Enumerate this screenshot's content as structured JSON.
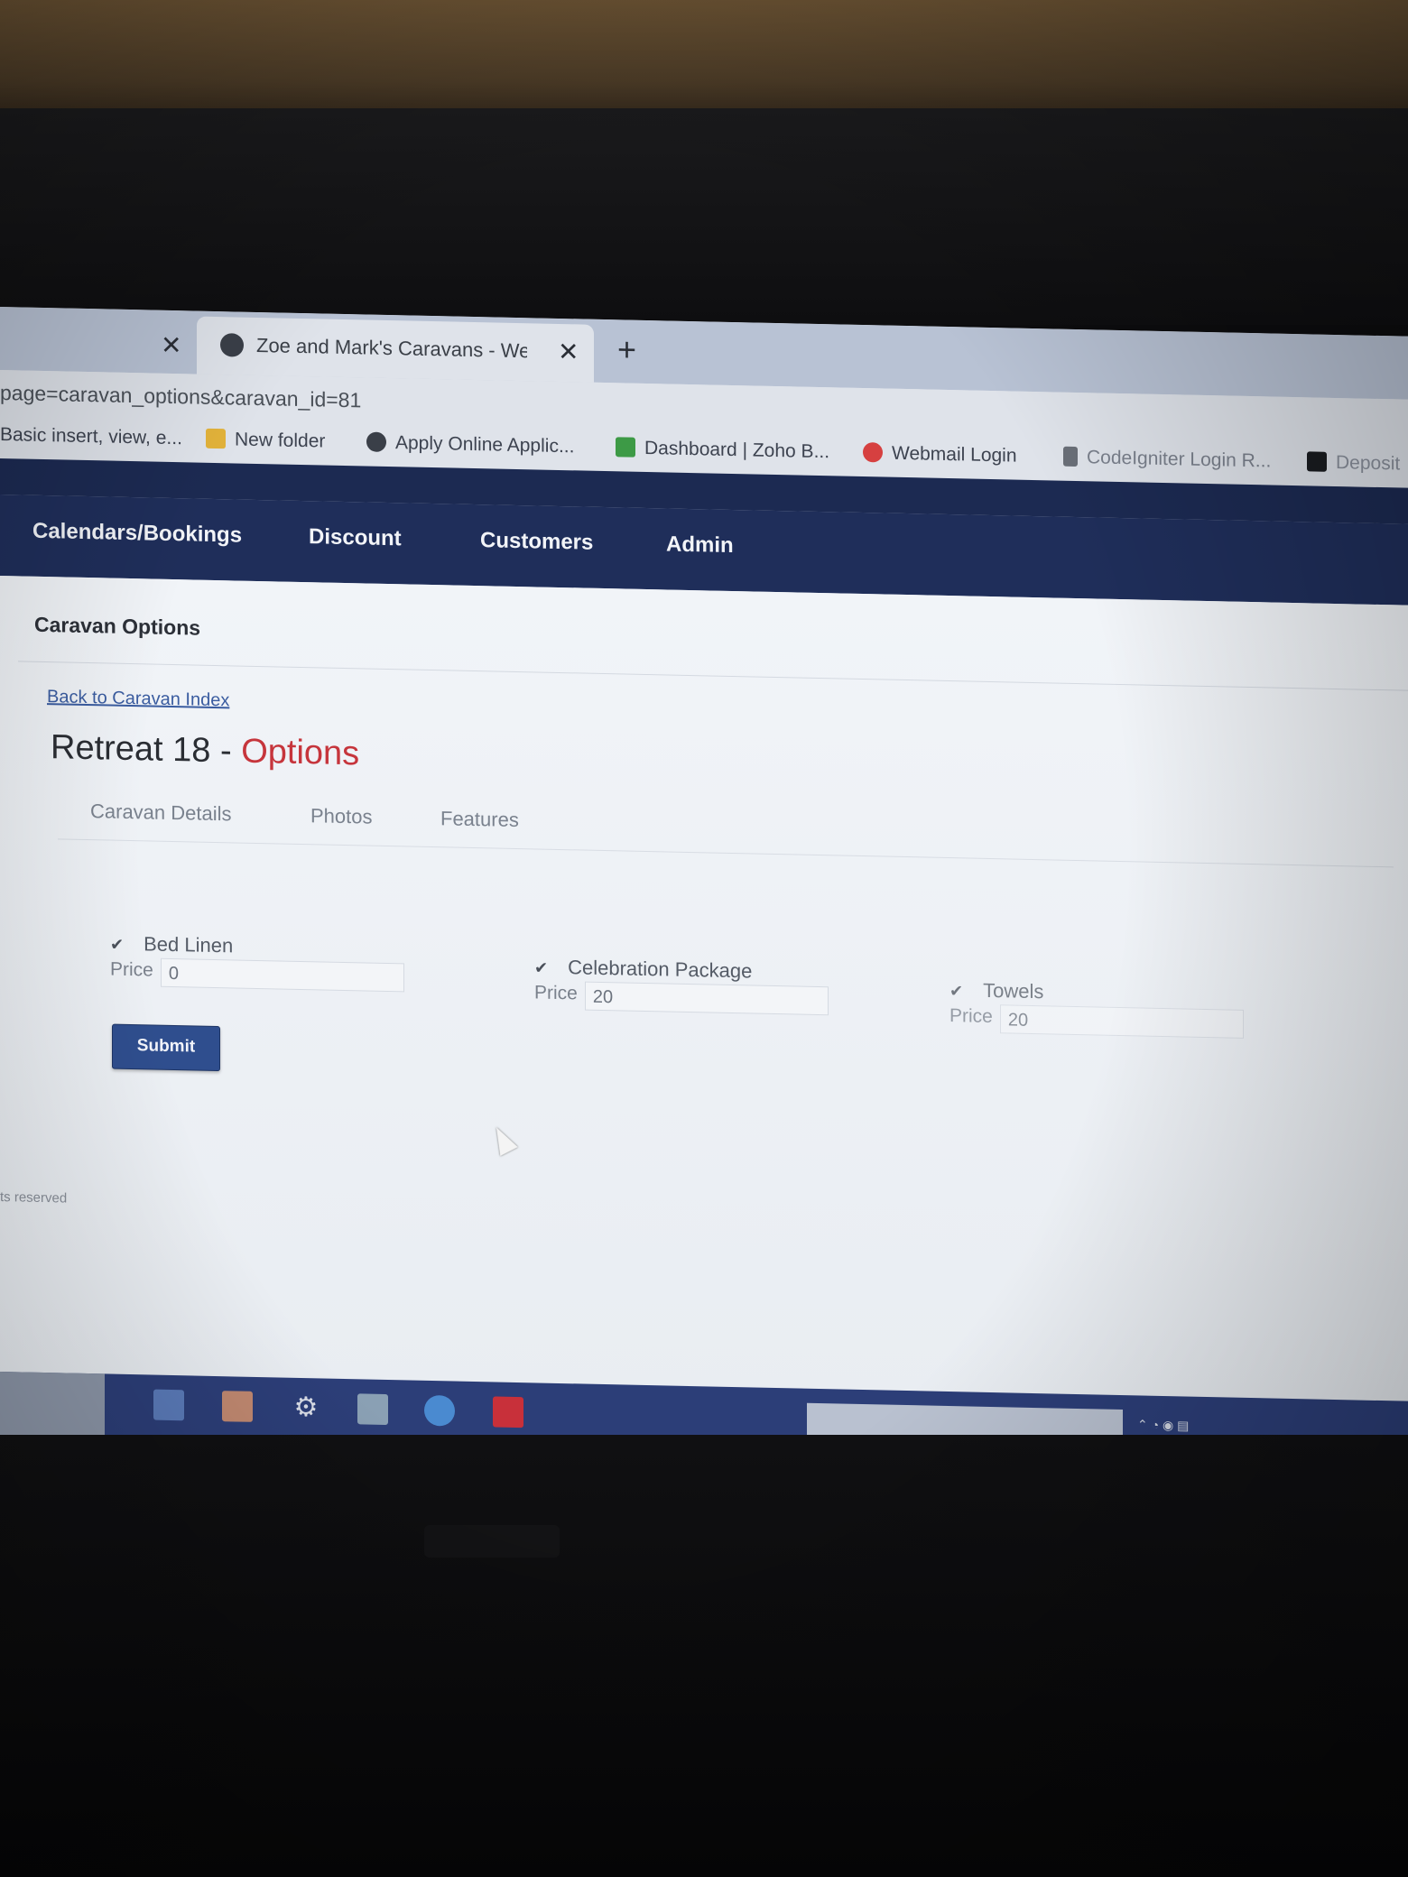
{
  "browser": {
    "active_tab_title": "Zoe and Mark's Caravans - Web",
    "url": "page=caravan_options&caravan_id=81",
    "bookmarks": [
      {
        "label": "Basic insert, view, e...",
        "icon": "doc-icon",
        "color": "#8a8f98"
      },
      {
        "label": "New folder",
        "icon": "folder-icon",
        "color": "#e2b23a"
      },
      {
        "label": "Apply Online Applic...",
        "icon": "globe-icon",
        "color": "#3a3f48"
      },
      {
        "label": "Dashboard | Zoho B...",
        "icon": "zoho-icon",
        "color": "#3d9a46"
      },
      {
        "label": "Webmail Login",
        "icon": "webmail-icon",
        "color": "#d64040"
      },
      {
        "label": "CodeIgniter Login R...",
        "icon": "text-icon",
        "color": "#6a6f78"
      },
      {
        "label": "Deposit",
        "icon": "bookmark-icon",
        "color": "#1a1c20"
      }
    ]
  },
  "nav": {
    "items": [
      "Calendars/Bookings",
      "Discount",
      "Customers",
      "Admin"
    ]
  },
  "page": {
    "panel_title": "Caravan Options",
    "back_link": "Back to Caravan Index",
    "heading_main": "Retreat 18 - ",
    "heading_accent": "Options",
    "tabs": [
      "Caravan Details",
      "Photos",
      "Features"
    ],
    "options": [
      {
        "label": "Bed Linen",
        "checked": true,
        "price_label": "Price",
        "price": "0"
      },
      {
        "label": "Celebration Package",
        "checked": true,
        "price_label": "Price",
        "price": "20"
      },
      {
        "label": "Towels",
        "checked": true,
        "price_label": "Price",
        "price": "20"
      }
    ],
    "submit_label": "Submit",
    "footer": "ts reserved"
  },
  "taskbar": {
    "icons": [
      {
        "name": "file-explorer-icon",
        "color": "#5a7ab8"
      },
      {
        "name": "store-icon",
        "color": "#c08870"
      },
      {
        "name": "settings-icon",
        "color": "#d8dce6"
      },
      {
        "name": "notepad-icon",
        "color": "#8aa0b4"
      },
      {
        "name": "chrome-icon",
        "color": "#4a8ad0"
      },
      {
        "name": "filezilla-icon",
        "color": "#c8303a"
      }
    ]
  },
  "colors": {
    "nav_bg": "#1f2e5a",
    "accent_red": "#c6353c",
    "submit_bg": "#2f4e8e"
  }
}
